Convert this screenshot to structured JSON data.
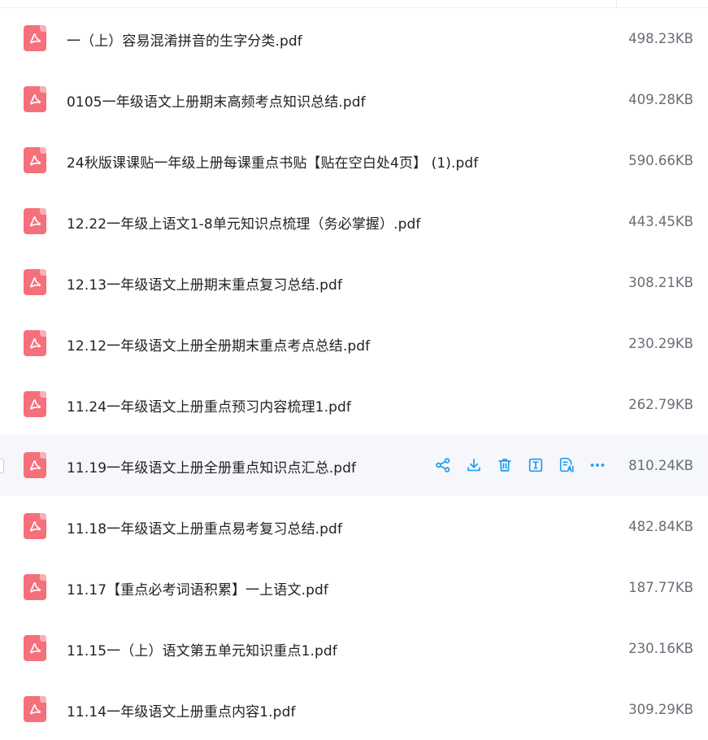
{
  "accent_color": "#1a9bf5",
  "pdf_icon_color": "#f5707a",
  "file_icon": "pdf-file-icon",
  "row_action_icons": [
    "share-icon",
    "download-icon",
    "delete-icon",
    "rename-icon",
    "ai-document-icon",
    "more-icon"
  ],
  "files": [
    {
      "name": "一（上）容易混淆拼音的生字分类.pdf",
      "size": "498.23KB",
      "selected": false
    },
    {
      "name": "0105一年级语文上册期末高频考点知识总结.pdf",
      "size": "409.28KB",
      "selected": false
    },
    {
      "name": "24秋版课课贴一年级上册每课重点书贴【贴在空白处4页】 (1).pdf",
      "size": "590.66KB",
      "selected": false
    },
    {
      "name": "12.22一年级上语文1-8单元知识点梳理（务必掌握）.pdf",
      "size": "443.45KB",
      "selected": false
    },
    {
      "name": "12.13一年级语文上册期末重点复习总结.pdf",
      "size": "308.21KB",
      "selected": false
    },
    {
      "name": "12.12一年级语文上册全册期末重点考点总结.pdf",
      "size": "230.29KB",
      "selected": false
    },
    {
      "name": "11.24一年级语文上册重点预习内容梳理1.pdf",
      "size": "262.79KB",
      "selected": false
    },
    {
      "name": "11.19一年级语文上册全册重点知识点汇总.pdf",
      "size": "810.24KB",
      "selected": true
    },
    {
      "name": "11.18一年级语文上册重点易考复习总结.pdf",
      "size": "482.84KB",
      "selected": false
    },
    {
      "name": "11.17【重点必考词语积累】一上语文.pdf",
      "size": "187.77KB",
      "selected": false
    },
    {
      "name": "11.15一（上）语文第五单元知识重点1.pdf",
      "size": "230.16KB",
      "selected": false
    },
    {
      "name": "11.14一年级语文上册重点内容1.pdf",
      "size": "309.29KB",
      "selected": false
    }
  ]
}
